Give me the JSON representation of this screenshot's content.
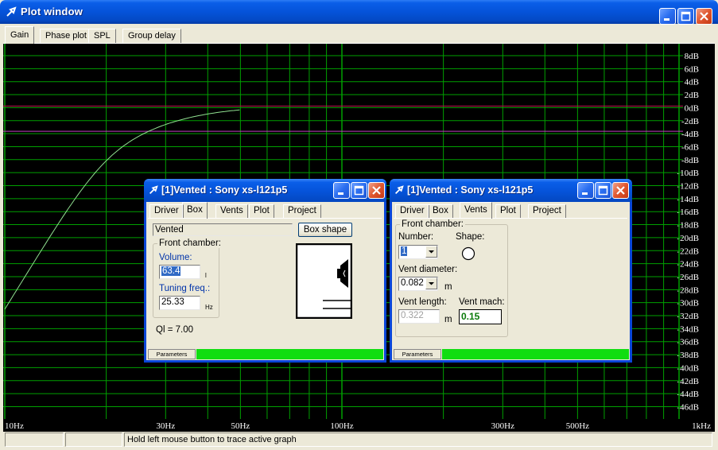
{
  "window": {
    "title": "Plot window",
    "tabs": [
      "Gain",
      "Phase plot",
      "SPL",
      "Group delay"
    ],
    "active_tab": "Gain"
  },
  "plot": {
    "y_labels": [
      "8dB",
      "6dB",
      "4dB",
      "2dB",
      "0dB",
      "-2dB",
      "-4dB",
      "-6dB",
      "-8dB",
      "-10dB",
      "-12dB",
      "-14dB",
      "-16dB",
      "-18dB",
      "-20dB",
      "-22dB",
      "-24dB",
      "-26dB",
      "-28dB",
      "-30dB",
      "-32dB",
      "-34dB",
      "-36dB",
      "-38dB",
      "-40dB",
      "-42dB",
      "-44dB",
      "-46dB"
    ],
    "x_labels": [
      "10Hz",
      "30Hz",
      "50Hz",
      "100Hz",
      "300Hz",
      "500Hz",
      "1kHz"
    ],
    "colors": {
      "background": "#000000",
      "grid": "#00a000",
      "curve": "#90e090",
      "ref_red": "#c01050",
      "ref_purple": "#c040c0",
      "label": "#ffffff"
    }
  },
  "statusbar": {
    "panel1": "",
    "panel2": "",
    "message": "Hold left mouse button to trace active graph"
  },
  "dialog_box": {
    "title": "[1]Vented : Sony xs-l121p5",
    "tabs": [
      "Driver",
      "Box",
      "Vents",
      "Plot",
      "Project"
    ],
    "active_tab": "Box",
    "box_type": "Vented",
    "box_shape_button": "Box shape",
    "group_label": "Front chamber:",
    "volume_label": "Volume:",
    "volume_value": "63.4",
    "volume_unit": "l",
    "tuning_label": "Tuning freq.:",
    "tuning_value": "25.33",
    "tuning_unit": "Hz",
    "ql_text": "Ql = 7.00",
    "bottom_tab": "Parameters"
  },
  "dialog_vents": {
    "title": "[1]Vented : Sony xs-l121p5",
    "tabs": [
      "Driver",
      "Box",
      "Vents",
      "Plot",
      "Project"
    ],
    "active_tab": "Vents",
    "group_label": "Front chamber:",
    "number_label": "Number:",
    "number_value": "1",
    "shape_label": "Shape:",
    "diameter_label": "Vent diameter:",
    "diameter_value": "0.082",
    "diameter_unit": "m",
    "length_label": "Vent length:",
    "length_value": "0.322",
    "length_unit": "m",
    "mach_label": "Vent mach:",
    "mach_value": "0.15",
    "bottom_tab": "Parameters"
  }
}
